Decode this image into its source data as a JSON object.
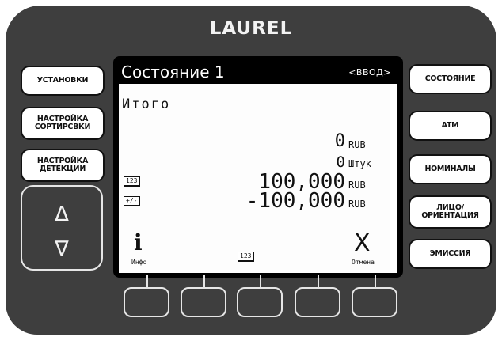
{
  "brand": "LAUREL",
  "left_buttons": [
    {
      "label": "УСТАНОВКИ"
    },
    {
      "label": "НАСТРОЙКА\nСОРТИРСВКИ"
    },
    {
      "label": "НАСТРОЙКА\nДЕТЕКЦИИ"
    }
  ],
  "arrows": {
    "up": "Δ",
    "down": "∇"
  },
  "right_buttons": [
    {
      "label": "СОСТОЯНИЕ"
    },
    {
      "label": "ATM"
    },
    {
      "label": "НОМИНАЛЫ"
    },
    {
      "label": "ЛИЦО/\nОРИЕНТАЦИЯ"
    },
    {
      "label": "ЭМИССИЯ"
    }
  ],
  "lcd": {
    "title": "Состояние 1",
    "mode": "<ВВОД>",
    "total_label": "Итого",
    "rows": [
      {
        "value": "0",
        "unit": "RUB"
      },
      {
        "value": "0",
        "unit": "Штук"
      },
      {
        "value": "100,000",
        "unit": "RUB",
        "icon": "123"
      },
      {
        "value": "-100,000",
        "unit": "RUB",
        "icon": "+/-"
      }
    ],
    "softkeys": {
      "info_glyph": "i",
      "info_label": "Инфо",
      "counter_icon": "123",
      "cancel_glyph": "X",
      "cancel_label": "Отмена"
    }
  }
}
